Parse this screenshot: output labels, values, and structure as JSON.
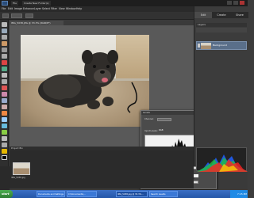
{
  "titlebar": {
    "tabs": [
      "File",
      "Create New Folder(s)"
    ]
  },
  "menu": {
    "items": [
      "File",
      "Edit",
      "Image",
      "Enhance",
      "Layer",
      "Select",
      "Filter",
      "View",
      "Window",
      "Help"
    ]
  },
  "document": {
    "tab_title": "IMG_5038.JPG @ 33.3% (RGB/8*)"
  },
  "panel_tabs": [
    "Edit",
    "Create",
    "Share"
  ],
  "layers": {
    "header": "Layers",
    "layer_name": "Background"
  },
  "dialog": {
    "title": "Levels",
    "channel_label": "Channel:",
    "channel_value": "RGB",
    "input_label": "Input Levels:",
    "output_label": "Output Levels:",
    "input_values": [
      "0",
      "1.00",
      "255"
    ],
    "output_values": [
      "0",
      "255"
    ],
    "buttons": [
      "OK",
      "Reset",
      "Help",
      "Auto"
    ]
  },
  "bin": {
    "header": "Project Bin",
    "thumb_label": "IMG_5038.jpg"
  },
  "taskbar": {
    "start": "start",
    "items": [
      "Documents and Settings",
      "C:\\Documents\\...",
      "IMG_5038.jpg @ 33.3%...",
      "Search results"
    ],
    "clock": "7:15 PM"
  },
  "colors": {
    "panel_bg": "#3c3c3c",
    "selection": "#5a6f8a",
    "taskbar": "#2456a8"
  }
}
